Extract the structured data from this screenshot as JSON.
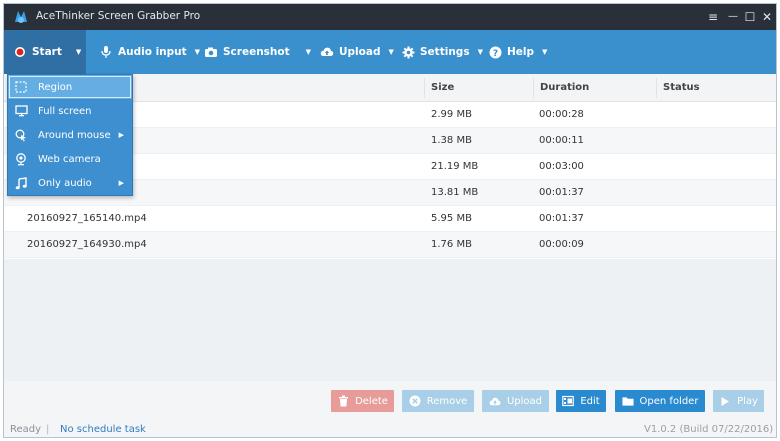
{
  "window": {
    "title": "AceThinker Screen Grabber Pro",
    "controls": {
      "menu": "≡",
      "minimize": "—",
      "maximize": "☐",
      "close": "✕"
    }
  },
  "toolbar": {
    "start_label": "Start",
    "audio_label": "Audio input",
    "screenshot_label": "Screenshot",
    "upload_label": "Upload",
    "settings_label": "Settings",
    "help_label": "Help",
    "caret": "▼"
  },
  "start_menu": {
    "items": [
      {
        "label": "Region",
        "icon": "region-icon",
        "highlighted": true,
        "has_submenu": false
      },
      {
        "label": "Full screen",
        "icon": "monitor-icon",
        "highlighted": false,
        "has_submenu": false
      },
      {
        "label": "Around mouse",
        "icon": "mouse-icon",
        "highlighted": false,
        "has_submenu": true
      },
      {
        "label": "Web camera",
        "icon": "webcam-icon",
        "highlighted": false,
        "has_submenu": false
      },
      {
        "label": "Only audio",
        "icon": "music-icon",
        "highlighted": false,
        "has_submenu": true
      }
    ],
    "submenu_arrow": "▶"
  },
  "table": {
    "columns": [
      "Size",
      "Duration",
      "Status"
    ],
    "rows": [
      {
        "name": "",
        "size": "2.99 MB",
        "duration": "00:00:28",
        "status": ""
      },
      {
        "name": "",
        "size": "1.38 MB",
        "duration": "00:00:11",
        "status": ""
      },
      {
        "name": "",
        "size": "21.19 MB",
        "duration": "00:03:00",
        "status": ""
      },
      {
        "name": "",
        "size": "13.81 MB",
        "duration": "00:01:37",
        "status": ""
      },
      {
        "name": "20160927_165140.mp4",
        "size": "5.95 MB",
        "duration": "00:01:37",
        "status": ""
      },
      {
        "name": "20160927_164930.mp4",
        "size": "1.76 MB",
        "duration": "00:00:09",
        "status": ""
      }
    ]
  },
  "actions": {
    "delete_label": "Delete",
    "remove_label": "Remove",
    "upload_label": "Upload",
    "edit_label": "Edit",
    "open_folder_label": "Open folder",
    "play_label": "Play"
  },
  "status_bar": {
    "state": "Ready",
    "separator": "|",
    "schedule": "No schedule task",
    "version": "V1.0.2 (Build 07/22/2016)"
  },
  "colors": {
    "titlebar": "#2a3039",
    "toolbar": "#3a8fcd",
    "delete_btn": "#e89c9a",
    "disabled_btn": "#a9cfe8",
    "enabled_btn": "#2a8ad0",
    "link": "#2f7dc1"
  }
}
